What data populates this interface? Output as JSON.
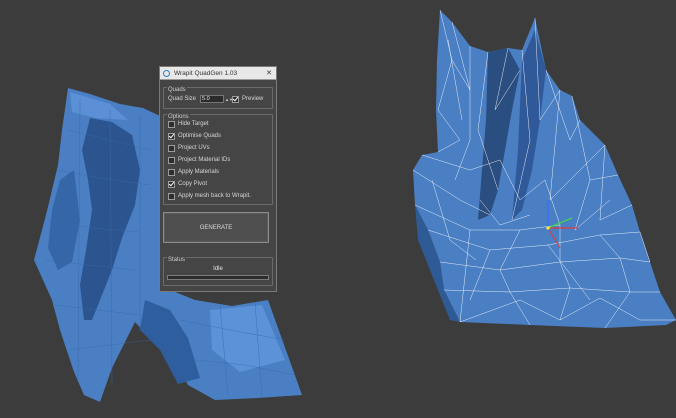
{
  "dialog": {
    "title": "Wrapit QuadGen 1.03",
    "close_glyph": "✕",
    "quads_group": {
      "label": "Quads",
      "quad_size_label": "Quad Size",
      "quad_size_value": "5.0",
      "spinner_glyph": "▲▼",
      "preview_label": "Preview",
      "preview_checked": true
    },
    "options_group": {
      "label": "Options",
      "items": [
        {
          "label": "Hide Target",
          "checked": false
        },
        {
          "label": "Optimise Quads",
          "checked": true
        },
        {
          "label": "Project UVs",
          "checked": false
        },
        {
          "label": "Project Material IDs",
          "checked": false
        },
        {
          "label": "Apply Materials",
          "checked": false
        },
        {
          "label": "Copy Pivot",
          "checked": true
        },
        {
          "label": "Apply mesh back to Wrapit.",
          "checked": false
        }
      ]
    },
    "generate_label": "GENERATE",
    "status_group": {
      "label": "Status",
      "text": "Idle",
      "progress": 0
    }
  },
  "viewport": {
    "background_color": "#3c3c3c",
    "mesh_fill_color": "#4a7fc4",
    "mesh_shade_color": "#2c5590",
    "wire_color": "#ffffff",
    "gizmo_axes": [
      "x-axis-red",
      "y-axis-green",
      "z-axis-blue"
    ]
  }
}
